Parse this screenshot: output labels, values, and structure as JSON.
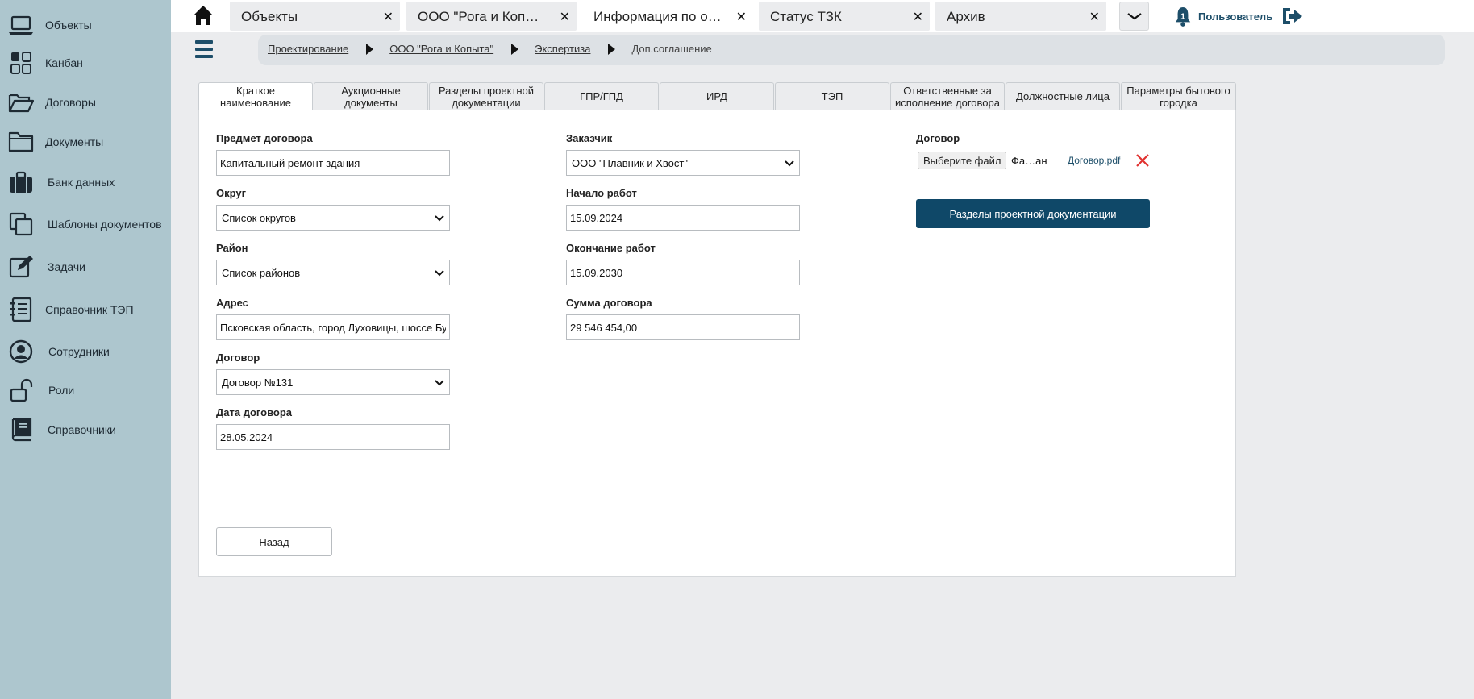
{
  "sidebar": {
    "items": [
      {
        "label": "Объекты",
        "icon": "laptop-icon"
      },
      {
        "label": "Канбан",
        "icon": "kanban-icon"
      },
      {
        "label": "Договоры",
        "icon": "folder-open-icon"
      },
      {
        "label": "Документы",
        "icon": "folder-icon"
      },
      {
        "label": "Банк данных",
        "icon": "briefcase-icon"
      },
      {
        "label": "Шаблоны документов",
        "icon": "copy-icon"
      },
      {
        "label": "Задачи",
        "icon": "edit-icon"
      },
      {
        "label": "Справочник ТЭП",
        "icon": "list-icon"
      },
      {
        "label": "Сотрудники",
        "icon": "user-circle-icon"
      },
      {
        "label": "Роли",
        "icon": "unlock-icon"
      },
      {
        "label": "Справочники",
        "icon": "book-icon"
      }
    ]
  },
  "topbar": {
    "tabs": [
      {
        "label": "Объекты",
        "close": "✕"
      },
      {
        "label": "ООО \"Рога и Копыта\"",
        "close": "✕"
      },
      {
        "label": "Информация по об...",
        "close": "✕"
      },
      {
        "label": "Статус ТЗК",
        "close": "✕"
      },
      {
        "label": "Архив",
        "close": "✕"
      }
    ],
    "notifications_count": "1",
    "user_label": "Пользователь"
  },
  "breadcrumb": {
    "items": [
      "Проектирование",
      "ООО \"Рога и Копыта\"",
      "Экспертиза"
    ],
    "current": "Доп.соглашение"
  },
  "subtabs": [
    "Краткое наименование",
    "Аукционные документы",
    "Разделы проектной документации",
    "ГПР/ГПД",
    "ИРД",
    "ТЭП",
    "Ответственные за исполнение договора",
    "Должностные лица",
    "Параметры бытового городка"
  ],
  "form": {
    "subject_label": "Предмет договора",
    "subject_value": "Капитальный ремонт здания",
    "district_label": "Округ",
    "district_value": "Список округов",
    "area_label": "Район",
    "area_value": "Список районов",
    "address_label": "Адрес",
    "address_value": "Псковская область, город Луховицы, шоссе Бу",
    "contract_label": "Договор",
    "contract_value": "Договор №131",
    "contract_date_label": "Дата договора",
    "contract_date_value": "28.05.2024",
    "customer_label": "Заказчик",
    "customer_value": "ООО \"Плавник и Хвост\"",
    "start_label": "Начало работ",
    "start_value": "15.09.2024",
    "end_label": "Окончание работ",
    "end_value": "15.09.2030",
    "sum_label": "Сумма договора",
    "sum_value": "29 546 454,00",
    "file_label": "Договор",
    "file_button": "Выберите файл",
    "file_status": "Фа…ан",
    "file_link": "Договор.pdf",
    "sections_button": "Разделы проектной документации",
    "back_button": "Назад"
  },
  "colors": {
    "sidebar_bg": "#adc6ce",
    "accent": "#0f4868",
    "remove": "#e0312f"
  }
}
